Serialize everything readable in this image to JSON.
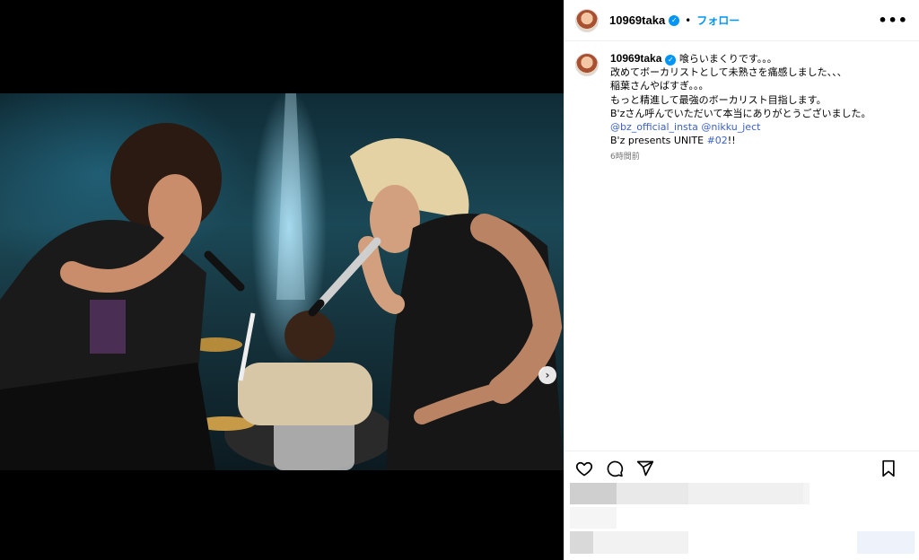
{
  "post": {
    "username": "10969taka",
    "follow_label": "フォロー",
    "more_label": "•••",
    "next_arrow": "›",
    "caption": {
      "lines": [
        "喰らいまくりです。。。",
        "改めてボーカリストとして未熟さを痛感しました、、、",
        "稲葉さんやばすぎ。。。",
        "もっと精進して最強のボーカリスト目指します。",
        "B'zさん呼んでいただいて本当にありがとうございました。"
      ],
      "mention_1": "@bz_official_insta",
      "mention_2": "@nikku_ject",
      "last_line_prefix": "B'z presents UNITE ",
      "hashtag": "#02",
      "last_line_suffix": "!!"
    },
    "timestamp": "6時間前"
  },
  "icons": {
    "verified": "verified-badge-icon",
    "like": "heart-icon",
    "comment": "comment-icon",
    "share": "send-icon",
    "save": "bookmark-icon",
    "next": "chevron-right-icon",
    "more": "more-options-icon"
  },
  "colors": {
    "accent": "#0095f6",
    "link": "#3a5fcd",
    "muted": "#737373"
  }
}
